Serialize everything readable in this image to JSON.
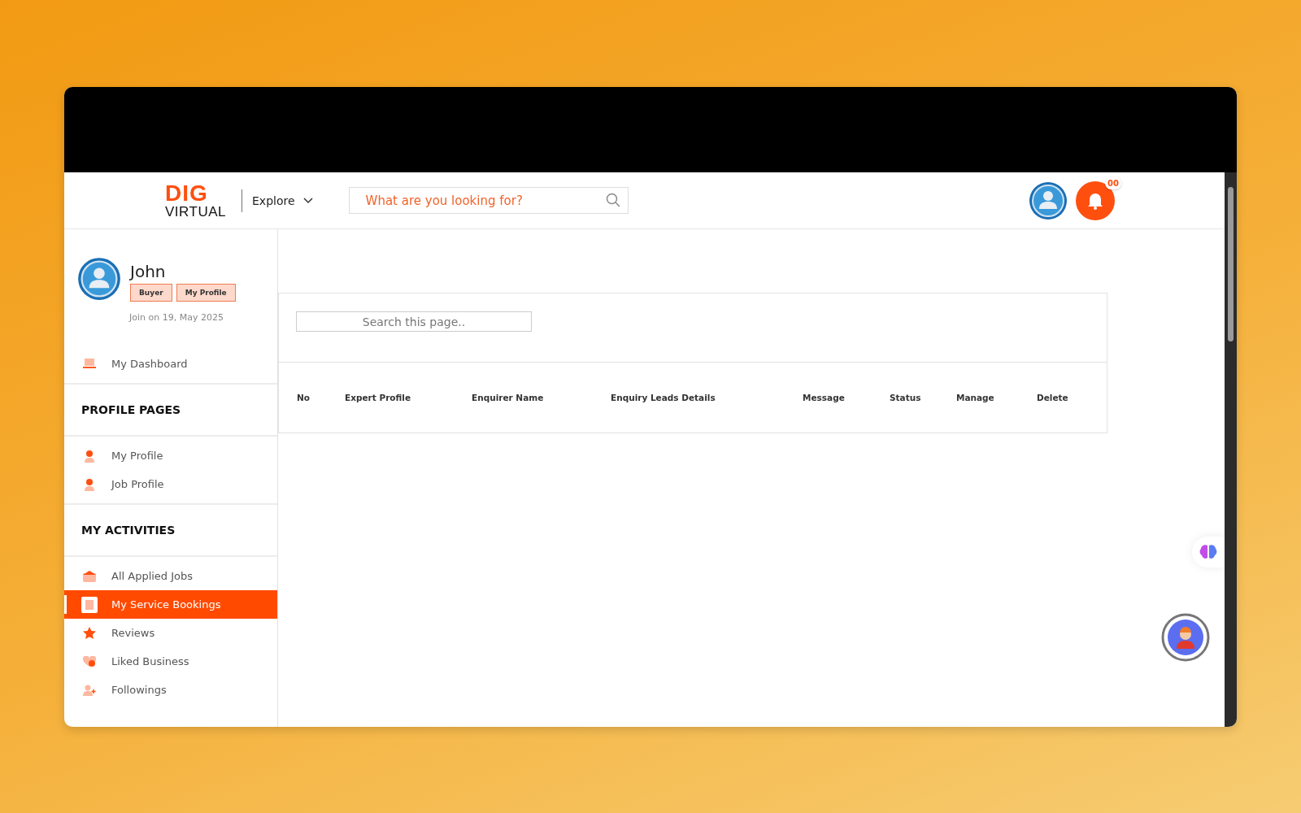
{
  "header": {
    "logo": {
      "top": "DIG",
      "bottom": "VIRTUAL"
    },
    "explore": "Explore",
    "search": {
      "placeholder": "What are you looking for?"
    },
    "notification_count": "00"
  },
  "profile": {
    "name": "John",
    "tags": [
      "Buyer",
      "My Profile"
    ],
    "joined": "Join on 19, May 2025"
  },
  "sidebar": [
    {
      "kind": "link",
      "label": "My Dashboard",
      "selected": false
    },
    {
      "kind": "heading",
      "label": "PROFILE PAGES"
    },
    {
      "kind": "link",
      "label": "My Profile",
      "selected": false
    },
    {
      "kind": "link",
      "label": "Job Profile",
      "selected": false
    },
    {
      "kind": "heading",
      "label": "MY ACTIVITIES"
    },
    {
      "kind": "link",
      "label": "All Applied Jobs",
      "selected": false
    },
    {
      "kind": "link",
      "label": "My Service Bookings",
      "selected": true
    },
    {
      "kind": "link",
      "label": "Reviews",
      "selected": false
    },
    {
      "kind": "link",
      "label": "Liked Business",
      "selected": false
    },
    {
      "kind": "link",
      "label": "Followings",
      "selected": false
    }
  ],
  "table": {
    "search": {
      "placeholder": "Search this page.."
    },
    "columns": [
      "No",
      "Expert Profile",
      "Enquirer Name",
      "Enquiry Leads Details",
      "Message",
      "Status",
      "Manage",
      "Delete"
    ]
  }
}
